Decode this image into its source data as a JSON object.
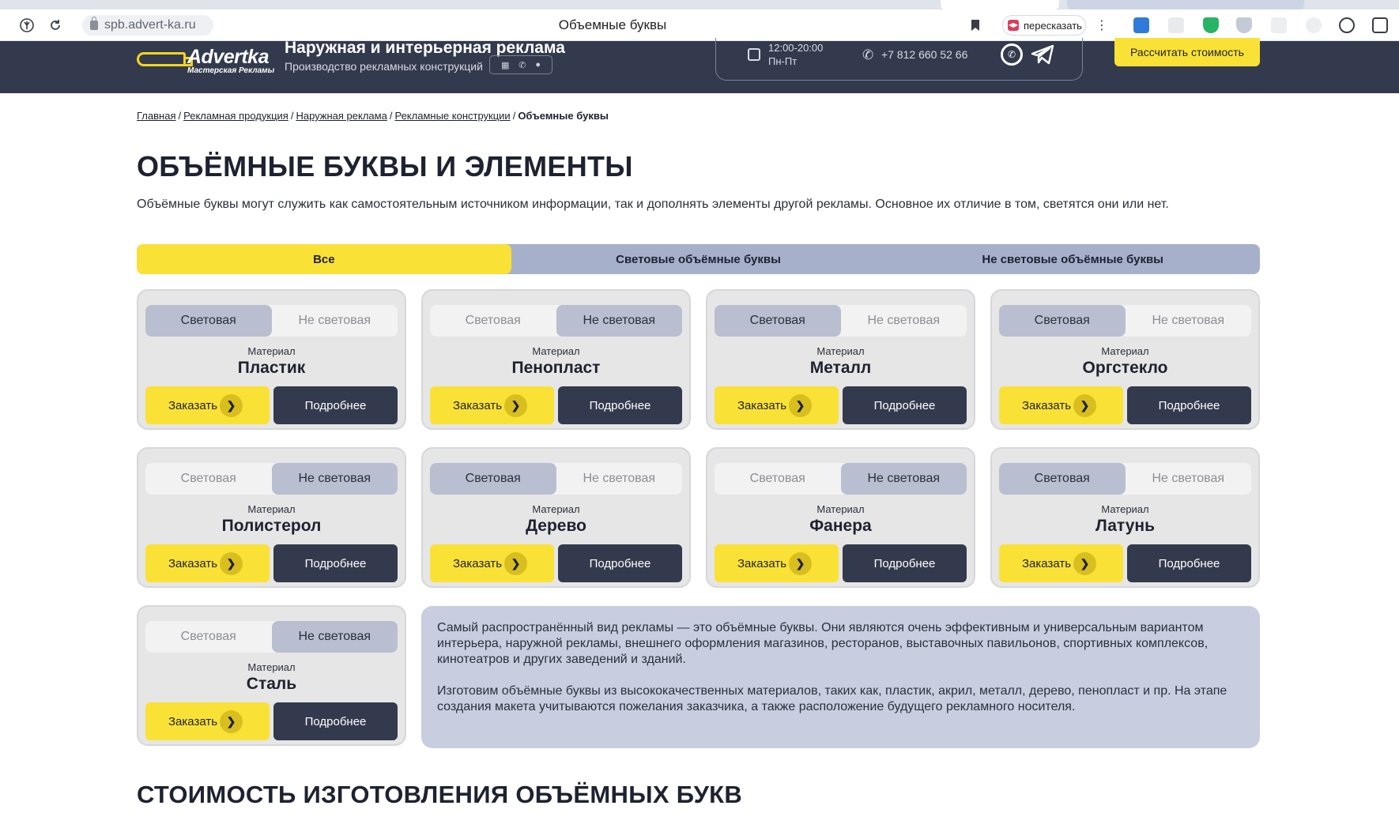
{
  "browser": {
    "url": "spb.advert-ka.ru",
    "tab_title": "Объемные буквы",
    "retell_label": "пересказать"
  },
  "header": {
    "logo_word": "Advertka",
    "logo_sub": "Мастерская Рекламы",
    "title": "Наружная и интерьерная реклама",
    "subtitle": "Производство рекламных конструкций",
    "hours_line1": "12:00-20:00",
    "hours_line2": "Пн-Пт",
    "phone": "+7 812 660 52 66",
    "cta_label": "Рассчитать стоимость"
  },
  "breadcrumb": {
    "items": [
      "Главная",
      "Рекламная продукция",
      "Наружная реклама",
      "Рекламные конструкции"
    ],
    "current": "Объемные буквы"
  },
  "page": {
    "title": "ОБЪЁМНЫЕ БУКВЫ И ЭЛЕМЕНТЫ",
    "lead": "Объёмные буквы могут служить как самостоятельным источником информации, так и дополнять элементы другой рекламы. Основное их отличие в том, светятся они или нет."
  },
  "filters": {
    "tabs": [
      {
        "label": "Все",
        "active": true
      },
      {
        "label": "Световые объёмные буквы",
        "active": false
      },
      {
        "label": "Не световые объёмные буквы",
        "active": false
      }
    ]
  },
  "cards": {
    "on_label": "Световая",
    "off_label": "Не световая",
    "material_label": "Материал",
    "order_label": "Заказать",
    "more_label": "Подробнее",
    "items": [
      {
        "name": "Пластик",
        "selected": "on"
      },
      {
        "name": "Пенопласт",
        "selected": "off"
      },
      {
        "name": "Металл",
        "selected": "on"
      },
      {
        "name": "Оргстекло",
        "selected": "on"
      },
      {
        "name": "Полистерол",
        "selected": "off"
      },
      {
        "name": "Дерево",
        "selected": "on"
      },
      {
        "name": "Фанера",
        "selected": "off"
      },
      {
        "name": "Латунь",
        "selected": "on"
      },
      {
        "name": "Сталь",
        "selected": "off"
      }
    ]
  },
  "info": {
    "p1": "Самый распространённый вид рекламы — это объёмные буквы. Они являются очень эффективным и универсальным вариантом интерьера, наружной рекламы, внешнего оформления магазинов, ресторанов, выставочных павильонов, спортивных комплексов, кинотеатров и других заведений и зданий.",
    "p2": "Изготовим объёмные буквы из высококачественных материалов, таких как, пластик, акрил, металл, дерево, пенопласт и пр. На этапе создания макета учитываются пожелания заказчика, а также расположение будущего рекламного носителя."
  },
  "section": {
    "title": "СТОИМОСТЬ ИЗГОТОВЛЕНИЯ ОБЪЁМНЫХ БУКВ"
  },
  "colors": {
    "header_bg": "#333a4d",
    "accent_yellow": "#fae136",
    "tab_bar": "#a7b0cb",
    "info_bg": "#c8cde0"
  }
}
